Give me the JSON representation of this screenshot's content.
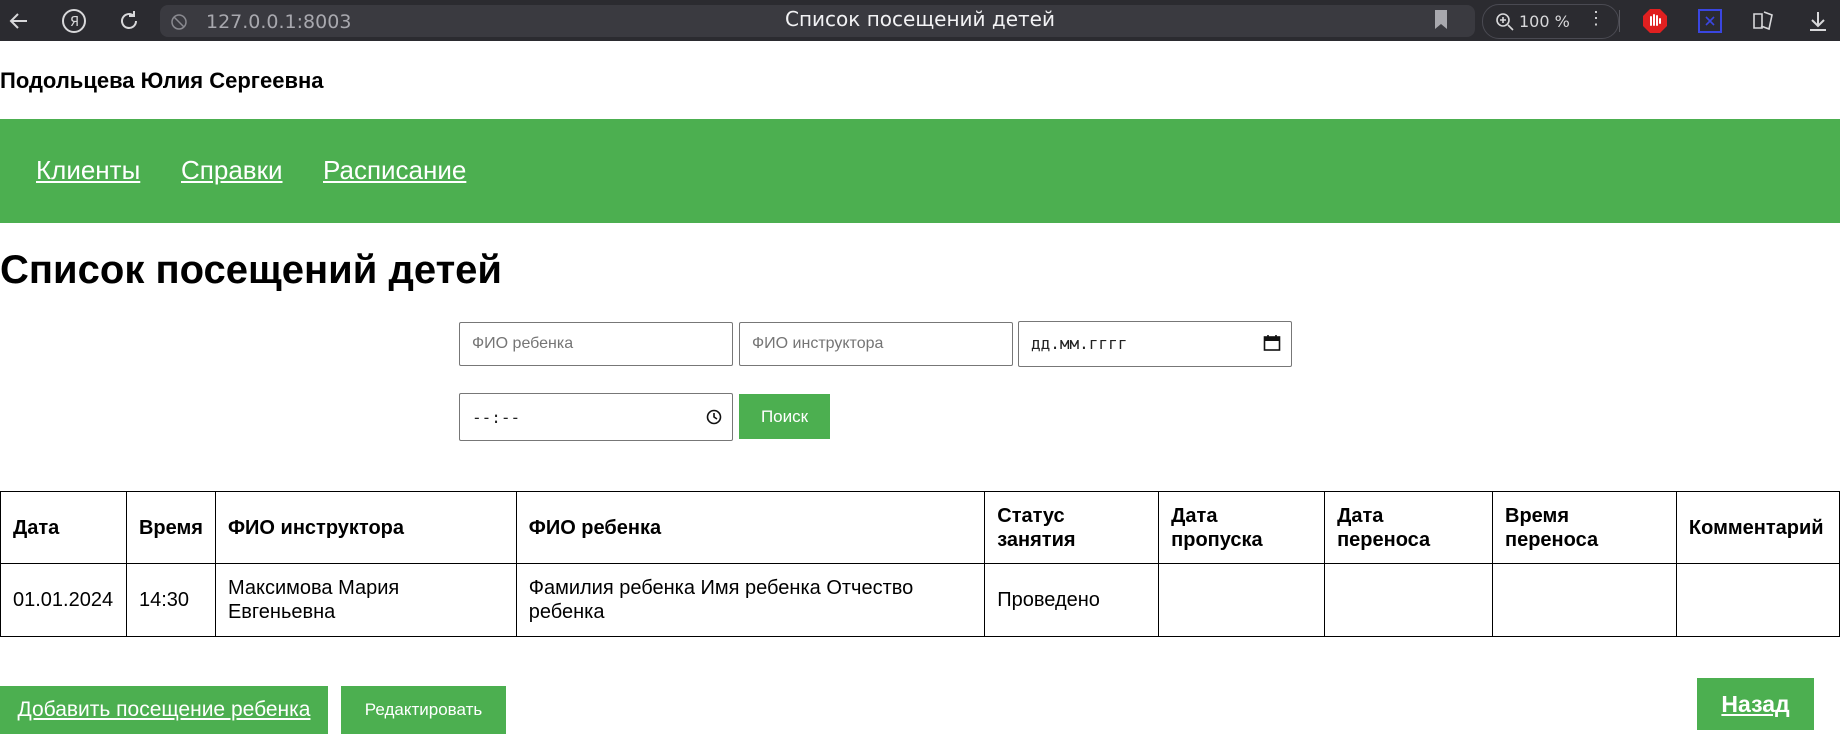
{
  "browser": {
    "url": "127.0.0.1:8003",
    "tab_title": "Список посещений детей",
    "zoom": "100 %"
  },
  "user": {
    "name": "Подольцева Юлия Сергеевна"
  },
  "nav": {
    "items": [
      {
        "label": "Клиенты"
      },
      {
        "label": "Справки"
      },
      {
        "label": "Расписание"
      }
    ]
  },
  "page": {
    "title": "Список посещений детей"
  },
  "filters": {
    "child_placeholder": "ФИО ребенка",
    "instructor_placeholder": "ФИО инструктора",
    "date_placeholder": "дд.мм.гггг",
    "time_placeholder": "--:--",
    "search_label": "Поиск"
  },
  "table": {
    "headers": [
      "Дата",
      "Время",
      "ФИО инструктора",
      "ФИО ребенка",
      "Статус занятия",
      "Дата пропуска",
      "Дата переноса",
      "Время переноса",
      "Комментарий"
    ],
    "rows": [
      [
        "01.01.2024",
        "14:30",
        "Максимова Мария Евгеньевна",
        "Фамилия ребенка Имя ребенка Отчество ребенка",
        "Проведено",
        "",
        "",
        "",
        ""
      ]
    ]
  },
  "actions": {
    "add_label": "Добавить посещение ребенка",
    "edit_label": "Редактировать",
    "back_label": "Назад"
  },
  "colors": {
    "accent": "#4caf50",
    "browser_bar": "#2b2b30"
  }
}
